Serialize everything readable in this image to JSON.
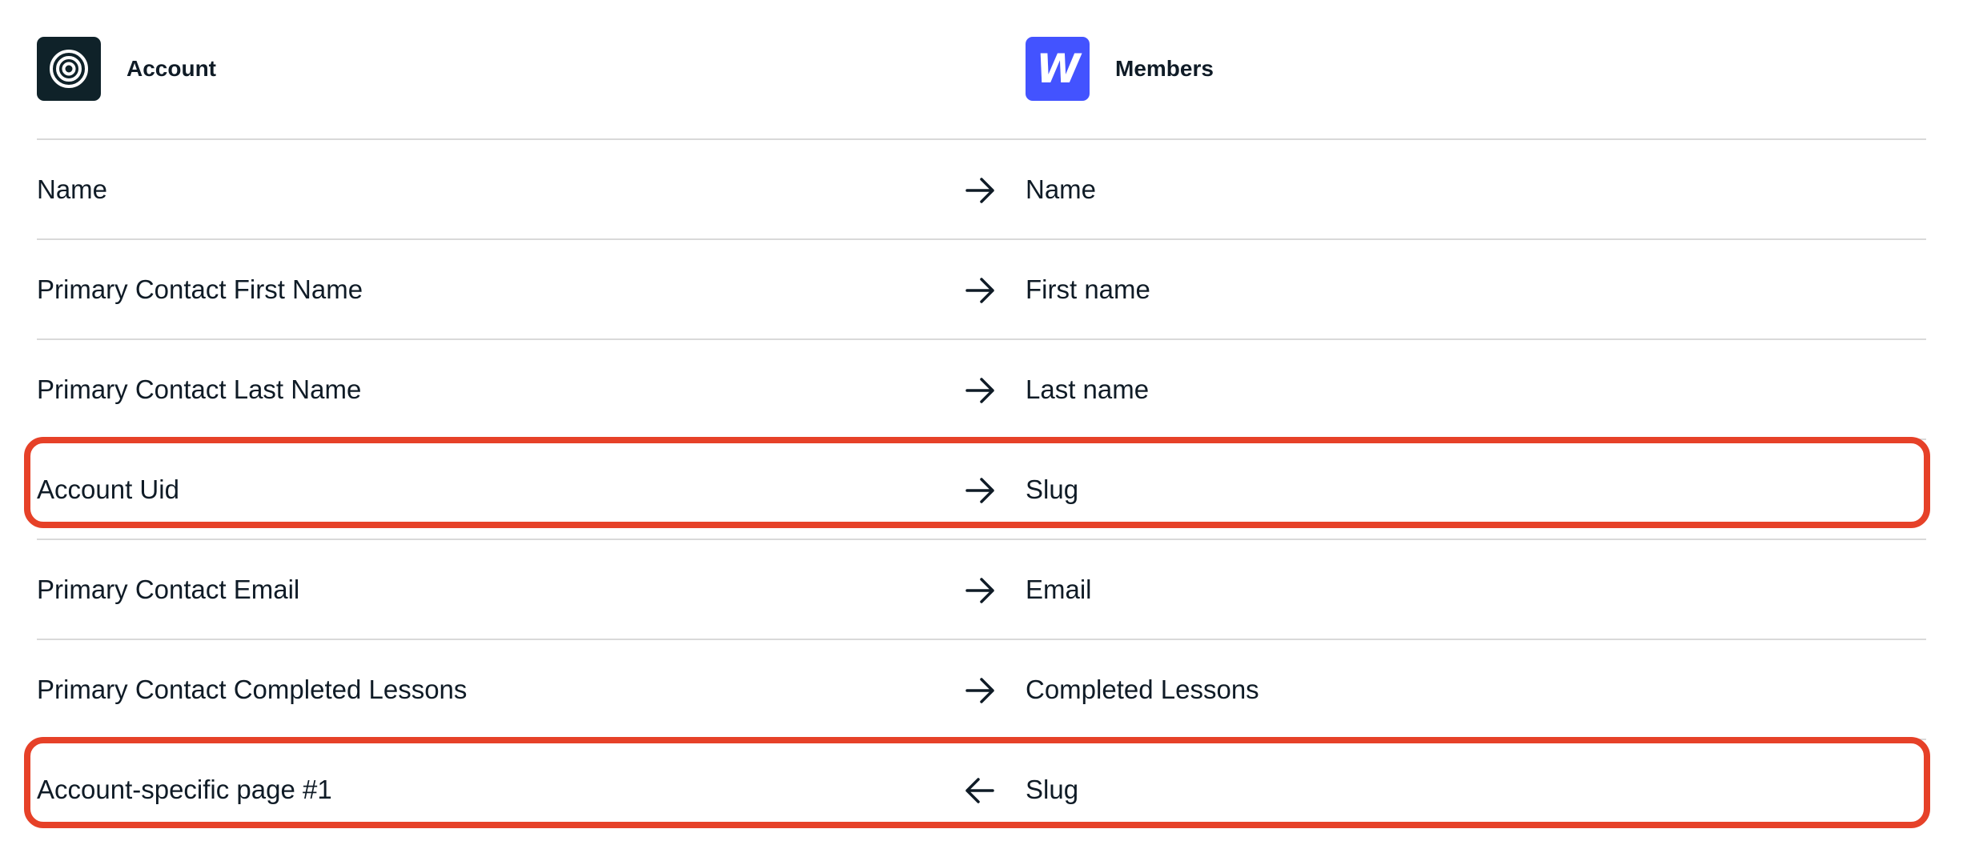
{
  "header": {
    "source_app": {
      "name": "Account",
      "icon": "concentric-circles-icon",
      "color": "#0f2229"
    },
    "target_app": {
      "name": "Members",
      "icon": "webflow-w-icon",
      "logo_letter": "W",
      "color": "#4353ff"
    }
  },
  "rows": [
    {
      "source": "Name",
      "direction": "right",
      "target": "Name",
      "highlighted": false
    },
    {
      "source": "Primary Contact First Name",
      "direction": "right",
      "target": "First name",
      "highlighted": false
    },
    {
      "source": "Primary Contact Last Name",
      "direction": "right",
      "target": "Last name",
      "highlighted": false
    },
    {
      "source": "Account Uid",
      "direction": "right",
      "target": "Slug",
      "highlighted": true
    },
    {
      "source": "Primary Contact Email",
      "direction": "right",
      "target": "Email",
      "highlighted": false
    },
    {
      "source": "Primary Contact Completed Lessons",
      "direction": "right",
      "target": "Completed Lessons",
      "highlighted": false
    },
    {
      "source": "Account-specific page #1",
      "direction": "left",
      "target": "Slug",
      "highlighted": true
    }
  ],
  "colors": {
    "highlight": "#e64128",
    "divider": "#d9d9d9",
    "text": "#0f1b26"
  }
}
